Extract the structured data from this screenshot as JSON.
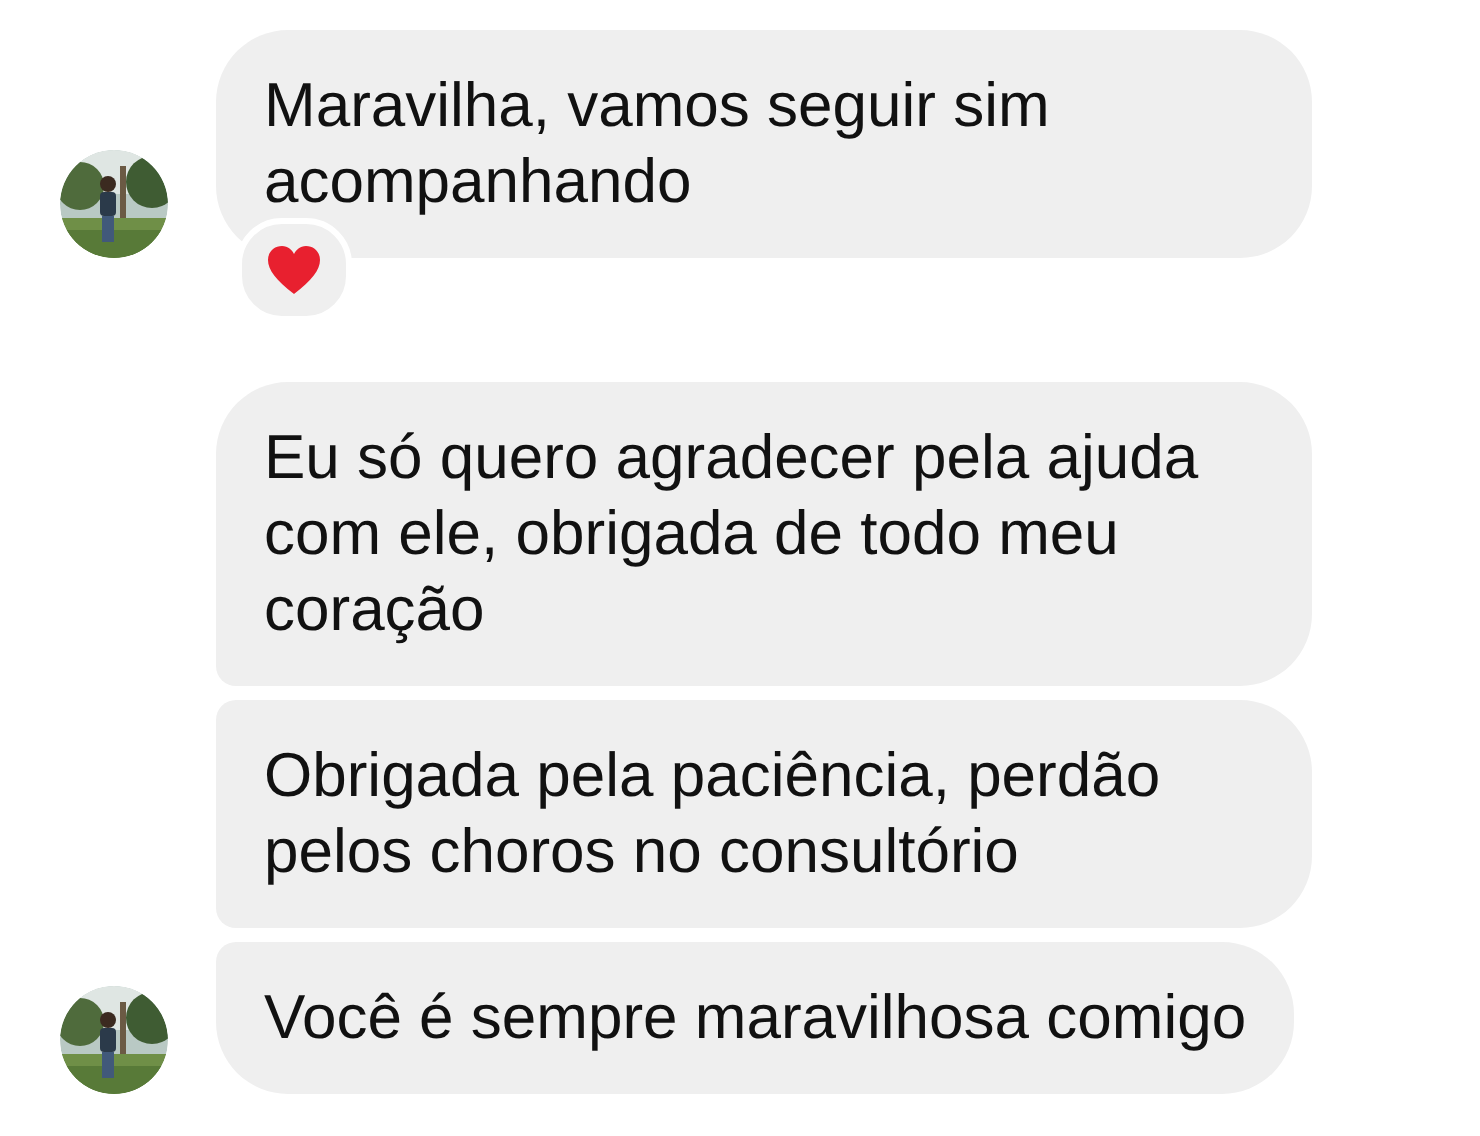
{
  "groups": [
    {
      "avatar": {
        "kind": "picture"
      },
      "messages": [
        {
          "text": "Maravilha, vamos seguir sim acompanhando",
          "reacted": true
        }
      ]
    },
    {
      "avatar": {
        "kind": "picture"
      },
      "messages": [
        {
          "text": "Eu só quero agradecer pela ajuda com ele, obrigada de todo meu coração",
          "reacted": false
        },
        {
          "text": "Obrigada pela paciência, perdão pelos choros no consultório",
          "reacted": false
        },
        {
          "text": "Você é sempre maravilhosa comigo",
          "reacted": false
        }
      ]
    }
  ]
}
